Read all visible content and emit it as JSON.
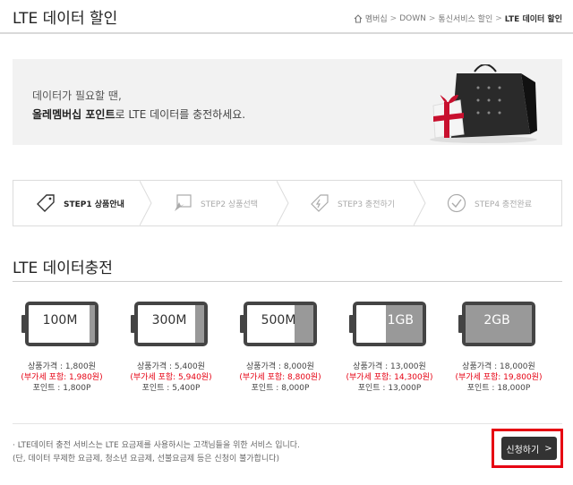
{
  "header": {
    "title": "LTE 데이터 할인",
    "breadcrumb": [
      "멤버십",
      "DOWN",
      "통신서비스 할인",
      "LTE 데이터 할인"
    ],
    "separator": ">"
  },
  "banner": {
    "line1": "데이터가 필요할 땐,",
    "line2_bold": "올레멤버십 포인트",
    "line2_rest": "로 LTE 데이터를 충전하세요."
  },
  "steps": [
    {
      "label": "STEP1 상품안내",
      "icon": "tag-icon",
      "active": true
    },
    {
      "label": "STEP2 상품선택",
      "icon": "cursor-select-icon",
      "active": false
    },
    {
      "label": "STEP3 충전하기",
      "icon": "charge-tag-icon",
      "active": false
    },
    {
      "label": "STEP4 충전완료",
      "icon": "check-circle-icon",
      "active": false
    }
  ],
  "section_title": "LTE 데이터충전",
  "products": [
    {
      "size": "100M",
      "fill": 0.08,
      "price": "상품가격 : 1,800원",
      "vat": "(부가세 포함: 1,980원)",
      "points": "포인트 : 1,800P"
    },
    {
      "size": "300M",
      "fill": 0.14,
      "price": "상품가격 : 5,400원",
      "vat": "(부가세 포함: 5,940원)",
      "points": "포인트 : 5,400P"
    },
    {
      "size": "500M",
      "fill": 0.28,
      "price": "상품가격 : 8,000원",
      "vat": "(부가세 포함: 8,800원)",
      "points": "포인트 : 8,000P"
    },
    {
      "size": "1GB",
      "fill": 0.55,
      "price": "상품가격 : 13,000원",
      "vat": "(부가세 포함: 14,300원)",
      "points": "포인트 : 13,000P"
    },
    {
      "size": "2GB",
      "fill": 1.0,
      "price": "상품가격 : 18,000원",
      "vat": "(부가세 포함: 19,800원)",
      "points": "포인트 : 18,000P"
    }
  ],
  "notice": {
    "line1": "· LTE데이터 충전 서비스는 LTE 요금제를 사용하시는 고객님들을 위한 서비스 입니다.",
    "line2": "(단, 데이터 무제한 요금제, 청소년 요금제, 선불요금제 등은 신청이 불가합니다)"
  },
  "apply_button": {
    "label": "신청하기",
    "arrow": ">"
  },
  "colors": {
    "accent_red": "#e60012",
    "dark": "#333333",
    "battery_fill": "#999999"
  }
}
